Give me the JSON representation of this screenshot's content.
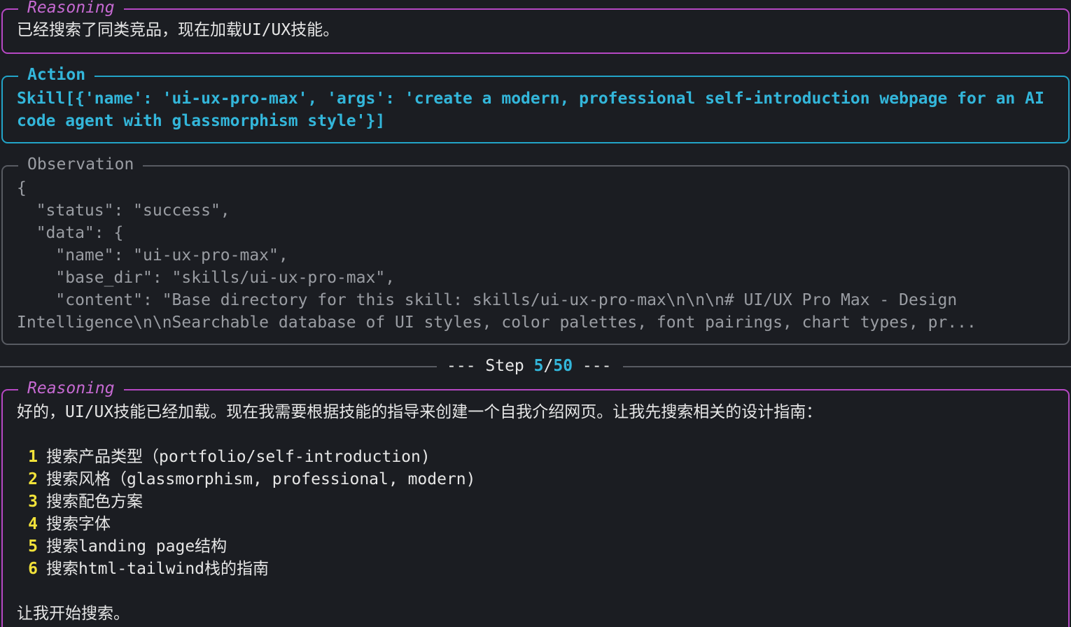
{
  "reasoning_1": {
    "title": "Reasoning",
    "text": "已经搜索了同类竞品，现在加载UI/UX技能。"
  },
  "action": {
    "title": "Action",
    "lines": [
      "Skill[{'name': 'ui-ux-pro-max', 'args': 'create a modern, professional self-introduction webpage for an AI",
      "code agent with glassmorphism style'}]"
    ]
  },
  "observation": {
    "title": "Observation",
    "lines": [
      "{",
      "  \"status\": \"success\",",
      "  \"data\": {",
      "    \"name\": \"ui-ux-pro-max\",",
      "    \"base_dir\": \"skills/ui-ux-pro-max\",",
      "    \"content\": \"Base directory for this skill: skills/ui-ux-pro-max\\n\\n\\n# UI/UX Pro Max - Design",
      "Intelligence\\n\\nSearchable database of UI styles, color palettes, font pairings, chart types, pr..."
    ]
  },
  "step": {
    "prefix": "--- Step ",
    "current": "5",
    "slash": "/",
    "total": "50",
    "suffix": " ---"
  },
  "reasoning_2": {
    "title": "Reasoning",
    "intro": "好的，UI/UX技能已经加载。现在我需要根据技能的指导来创建一个自我介绍网页。让我先搜索相关的设计指南：",
    "items": [
      {
        "num": "1",
        "text": "搜索产品类型（portfolio/self-introduction)"
      },
      {
        "num": "2",
        "text": "搜索风格（glassmorphism, professional, modern)"
      },
      {
        "num": "3",
        "text": "搜索配色方案"
      },
      {
        "num": "4",
        "text": "搜索字体"
      },
      {
        "num": "5",
        "text": "搜索landing page结构"
      },
      {
        "num": "6",
        "text": "搜索html-tailwind栈的指南"
      }
    ],
    "outro": "让我开始搜索。"
  },
  "colors": {
    "background": "#1b1d22",
    "reasoning_border": "#b648c4",
    "action_accent": "#33b6da",
    "observation_text": "#9a9da3",
    "list_number": "#f2e23a"
  }
}
